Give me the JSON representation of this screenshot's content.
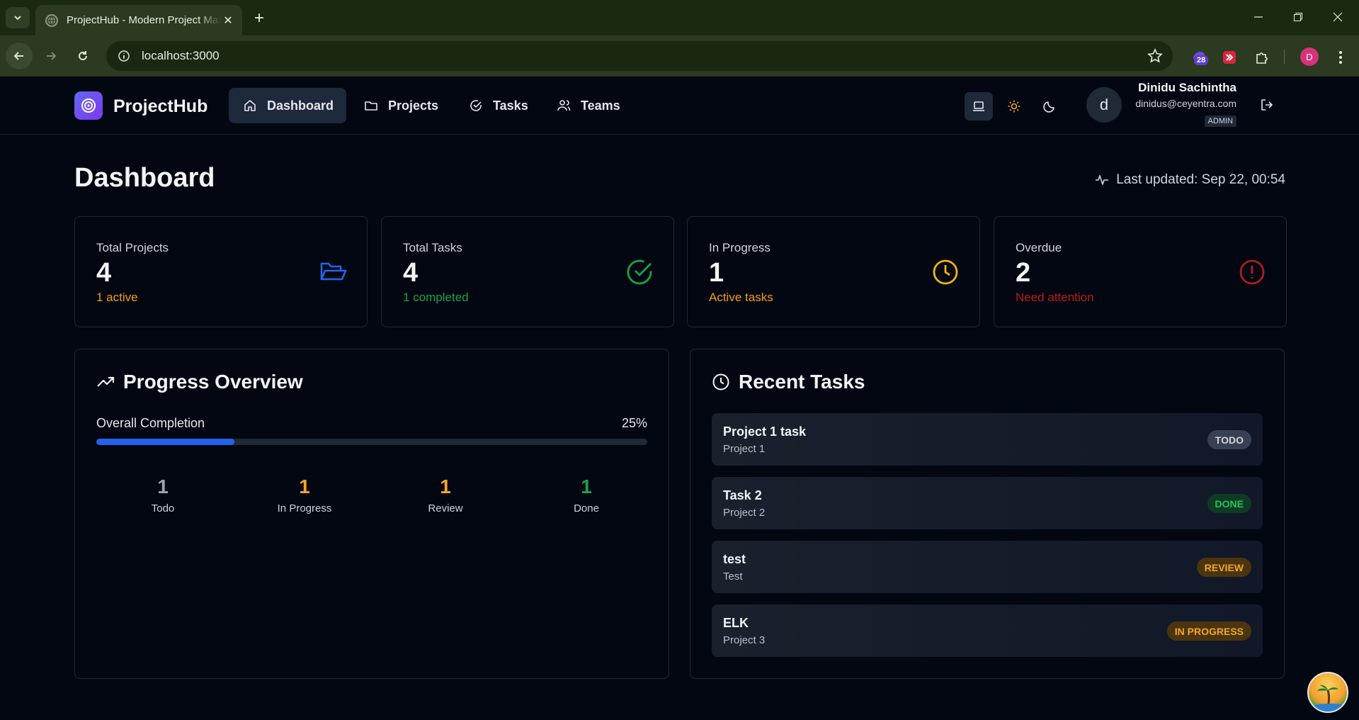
{
  "browser": {
    "tab_title": "ProjectHub - Modern Project Management",
    "url": "localhost:3000",
    "extension_badge": "28",
    "profile_initial": "D"
  },
  "header": {
    "brand": "ProjectHub",
    "nav": [
      {
        "label": "Dashboard",
        "icon": "home-icon",
        "active": true
      },
      {
        "label": "Projects",
        "icon": "folder-icon",
        "active": false
      },
      {
        "label": "Tasks",
        "icon": "check-circle-icon",
        "active": false
      },
      {
        "label": "Teams",
        "icon": "users-icon",
        "active": false
      }
    ],
    "theme_options": [
      "laptop-icon",
      "sun-icon",
      "moon-icon"
    ],
    "user": {
      "initial": "d",
      "name": "Dinidu Sachintha",
      "email": "dinidus@ceyentra.com",
      "role": "ADMIN"
    }
  },
  "page": {
    "title": "Dashboard",
    "last_updated": "Last updated: Sep 22, 00:54"
  },
  "stats": [
    {
      "label": "Total Projects",
      "value": "4",
      "sub": "1 active",
      "sub_color": "#f59e0b",
      "icon": "folder-open-icon",
      "icon_color": "#2563eb"
    },
    {
      "label": "Total Tasks",
      "value": "4",
      "sub": "1 completed",
      "sub_color": "#16a34a",
      "icon": "check-circle-icon",
      "icon_color": "#16a34a"
    },
    {
      "label": "In Progress",
      "value": "1",
      "sub": "Active tasks",
      "sub_color": "#f59e0b",
      "icon": "clock-icon",
      "icon_color": "#f5b50b"
    },
    {
      "label": "Overdue",
      "value": "2",
      "sub": "Need attention",
      "sub_color": "#b91c1c",
      "icon": "alert-circle-icon",
      "icon_color": "#b91c1c"
    }
  ],
  "progress": {
    "title": "Progress Overview",
    "completion_label": "Overall Completion",
    "completion_pct": "25%",
    "completion_fraction": 0.25,
    "counts": [
      {
        "value": "1",
        "label": "Todo",
        "color": "#9ca3af"
      },
      {
        "value": "1",
        "label": "In Progress",
        "color": "#f5a623"
      },
      {
        "value": "1",
        "label": "Review",
        "color": "#f5a623"
      },
      {
        "value": "1",
        "label": "Done",
        "color": "#16a34a"
      }
    ]
  },
  "recent": {
    "title": "Recent Tasks",
    "tasks": [
      {
        "name": "Project 1 task",
        "project": "Project 1",
        "status": "TODO",
        "badge_bg": "#374151",
        "badge_fg": "#d1d5db"
      },
      {
        "name": "Task 2",
        "project": "Project 2",
        "status": "DONE",
        "badge_bg": "#0f3b24",
        "badge_fg": "#22c55e"
      },
      {
        "name": "test",
        "project": "Test",
        "status": "REVIEW",
        "badge_bg": "#4a3510",
        "badge_fg": "#f5a623"
      },
      {
        "name": "ELK",
        "project": "Project 3",
        "status": "IN PROGRESS",
        "badge_bg": "#4a3510",
        "badge_fg": "#f5a623"
      }
    ]
  }
}
